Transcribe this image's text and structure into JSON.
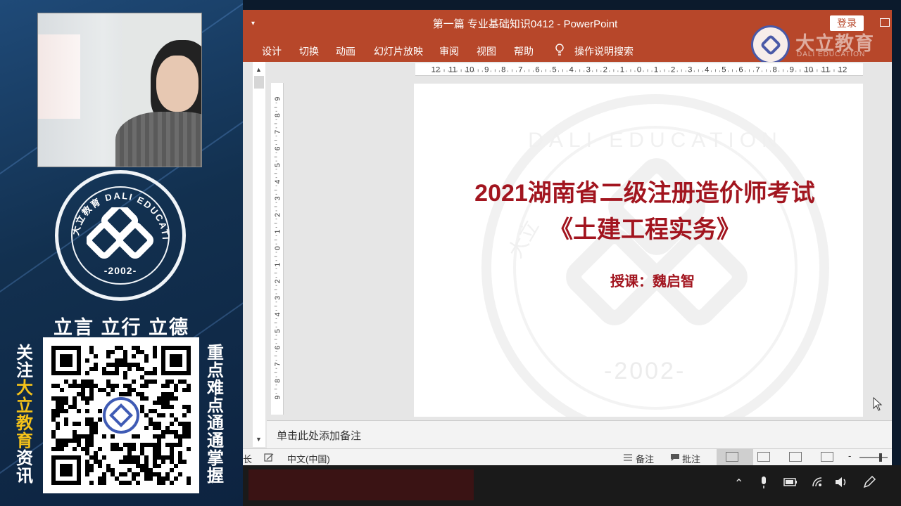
{
  "promo": {
    "logo_ring_text": "大立教育 DALI EDUCATION",
    "logo_year": "-2002-",
    "slogan": "立言 立行 立德",
    "left_vertical": [
      "关",
      "注",
      "大",
      "立",
      "教",
      "育",
      "资",
      "讯"
    ],
    "right_vertical": [
      "重",
      "点",
      "难",
      "点",
      "通",
      "通",
      "掌",
      "握"
    ],
    "colors": {
      "highlight": "#f4c21a",
      "text": "#ffffff"
    }
  },
  "window": {
    "title": "第一篇 专业基础知识0412  -  PowerPoint",
    "quick_access": "▾",
    "login_button": "登录",
    "brand_cn": "大立教育",
    "brand_en": "DALI EDUCATION",
    "accent": "#b7472a"
  },
  "ribbon": {
    "tabs": [
      "设计",
      "切换",
      "动画",
      "幻灯片放映",
      "审阅",
      "视图",
      "帮助"
    ],
    "search_label": "操作说明搜索"
  },
  "rulers": {
    "horizontal": [
      "12",
      "11",
      "10",
      "9",
      "8",
      "7",
      "6",
      "5",
      "4",
      "3",
      "2",
      "1",
      "0",
      "1",
      "2",
      "3",
      "4",
      "5",
      "6",
      "7",
      "8",
      "9",
      "10",
      "11",
      "12"
    ],
    "vertical": [
      "9",
      "8",
      "7",
      "6",
      "5",
      "4",
      "3",
      "2",
      "1",
      "0",
      "1",
      "2",
      "3",
      "4",
      "5",
      "6",
      "7",
      "8",
      "9"
    ]
  },
  "slide": {
    "title_line1": "2021湖南省二级注册造价师考试",
    "title_line2": "《土建工程实务》",
    "lecturer": "授课：魏启智",
    "watermark_text": "DALI EDUCATION",
    "watermark_cn": "大立",
    "watermark_year": "-2002-",
    "title_color": "#a2151f"
  },
  "notes": {
    "placeholder": "单击此处添加备注"
  },
  "statusbar": {
    "left_glyph": "长",
    "language": "中文(中国)",
    "notes_label": "备注",
    "comments_label": "批注"
  }
}
